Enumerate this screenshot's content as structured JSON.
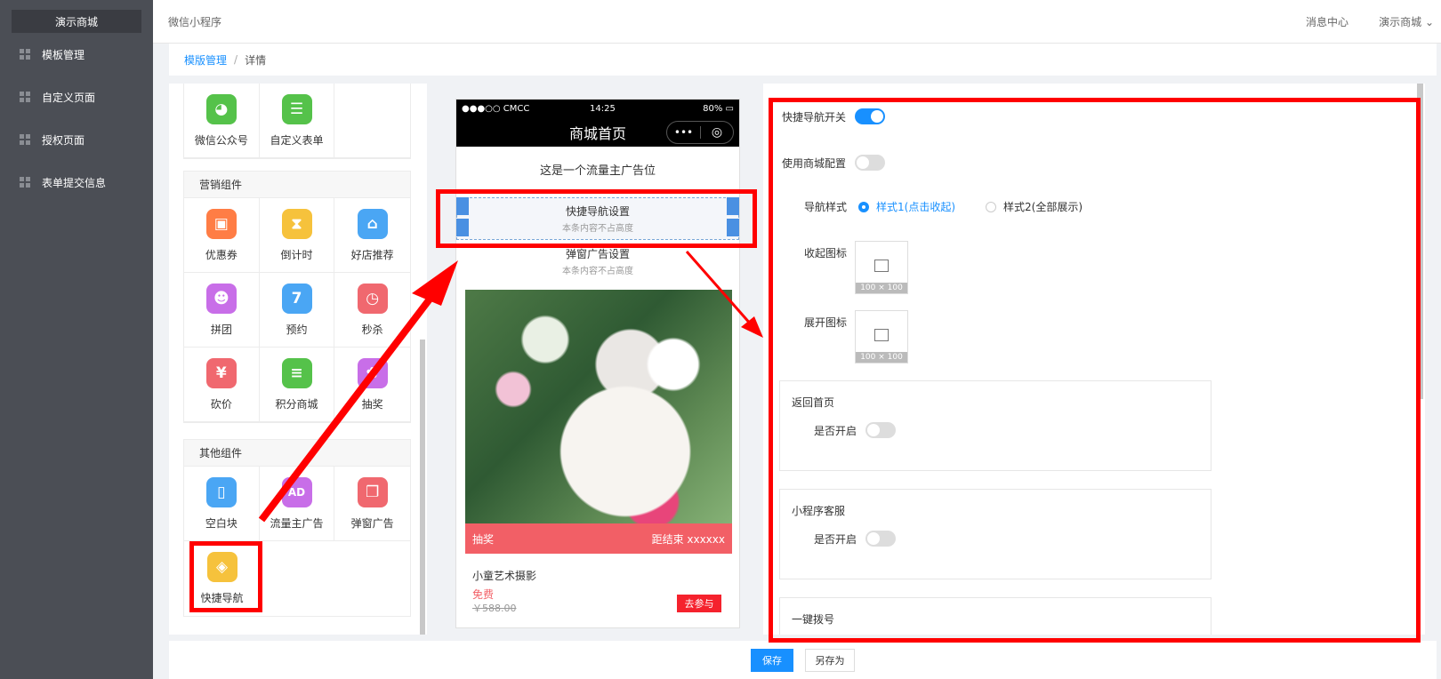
{
  "sidebar": {
    "brand": "演示商城",
    "items": [
      {
        "label": "模板管理"
      },
      {
        "label": "自定义页面"
      },
      {
        "label": "授权页面"
      },
      {
        "label": "表单提交信息"
      }
    ]
  },
  "header": {
    "app_name": "微信小程序",
    "messages": "消息中心",
    "user": "演示商城"
  },
  "breadcrumb": {
    "link": "模版管理",
    "separator": "/",
    "current": "详情"
  },
  "palette": {
    "top_items": [
      {
        "label": "微信公众号",
        "icon": "wechat-icon",
        "color": "#55c24a"
      },
      {
        "label": "自定义表单",
        "icon": "form-icon",
        "color": "#55c24a"
      }
    ],
    "marketing": {
      "title": "营销组件",
      "items": [
        {
          "label": "优惠券",
          "icon": "coupon-icon",
          "color": "#ff7d45"
        },
        {
          "label": "倒计时",
          "icon": "hourglass-icon",
          "color": "#f6c23c"
        },
        {
          "label": "好店推荐",
          "icon": "store-icon",
          "color": "#4aa6f4"
        },
        {
          "label": "拼团",
          "icon": "group-icon",
          "color": "#c86ee8"
        },
        {
          "label": "预约",
          "icon": "calendar-icon",
          "color": "#4aa6f4"
        },
        {
          "label": "秒杀",
          "icon": "alarm-icon",
          "color": "#f0686f"
        },
        {
          "label": "砍价",
          "icon": "yuan-icon",
          "color": "#f0686f"
        },
        {
          "label": "积分商城",
          "icon": "coins-icon",
          "color": "#55c24a"
        },
        {
          "label": "抽奖",
          "icon": "gift-icon",
          "color": "#c86ee8"
        }
      ]
    },
    "other": {
      "title": "其他组件",
      "items": [
        {
          "label": "空白块",
          "icon": "blank-doc-icon",
          "color": "#4aa6f4"
        },
        {
          "label": "流量主广告",
          "icon": "ad-icon",
          "color": "#c86ee8"
        },
        {
          "label": "弹窗广告",
          "icon": "popup-icon",
          "color": "#f0686f"
        },
        {
          "label": "快捷导航",
          "icon": "compass-icon",
          "color": "#f6c23c"
        }
      ]
    }
  },
  "preview": {
    "carrier": "●●●○○ CMCC",
    "time": "14:25",
    "battery": "80%",
    "title": "商城首页",
    "capsule_dots": "•••",
    "capsule_ring": "◎",
    "ad_text": "这是一个流量主广告位",
    "quick_nav_title": "快捷导航设置",
    "quick_nav_sub": "本条内容不占高度",
    "popup_title": "弹窗广告设置",
    "popup_sub": "本条内容不占高度",
    "lottery_label": "抽奖",
    "countdown": "距结束 xxxxxx",
    "product_title": "小童艺术摄影",
    "price_free": "免费",
    "price_old": "￥588.00",
    "join_label": "去参与"
  },
  "settings": {
    "quick_nav_switch": {
      "label": "快捷导航开关",
      "on": true
    },
    "use_mall_config": {
      "label": "使用商城配置",
      "on": false
    },
    "nav_style": {
      "label": "导航样式",
      "options": [
        {
          "label": "样式1(点击收起)",
          "selected": true
        },
        {
          "label": "样式2(全部展示)",
          "selected": false
        }
      ]
    },
    "collapse_icon": {
      "label": "收起图标",
      "size": "100 × 100"
    },
    "expand_icon": {
      "label": "展开图标",
      "size": "100 × 100"
    },
    "cards": [
      {
        "title": "返回首页",
        "switch_label": "是否开启",
        "on": false
      },
      {
        "title": "小程序客服",
        "switch_label": "是否开启",
        "on": false
      },
      {
        "title": "一键拨号"
      }
    ]
  },
  "footer": {
    "save": "保存",
    "save_as": "另存为"
  },
  "colors": {
    "accent": "#1890ff",
    "annotation": "#ff0000",
    "sidebar_bg": "#4b4e55"
  }
}
